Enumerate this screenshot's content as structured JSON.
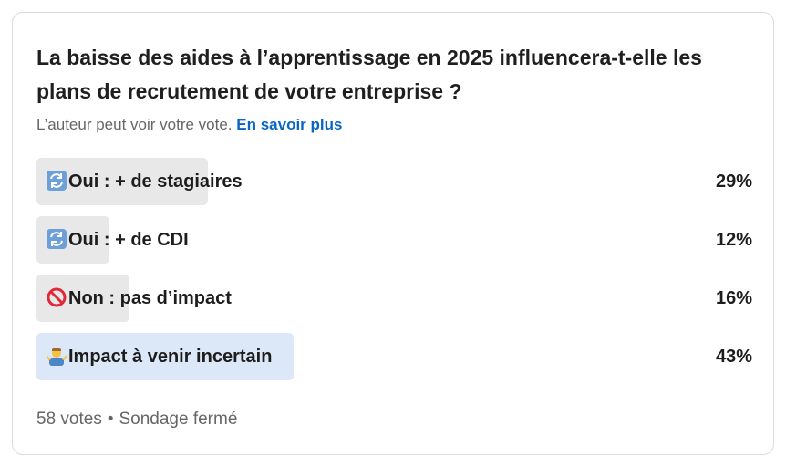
{
  "poll": {
    "question": "La baisse des aides à l’apprentissage en 2025 influencera-t-elle les plans de recrutement de votre entreprise ?",
    "visibility_note": "L’auteur peut voir votre vote.",
    "learn_more": "En savoir plus",
    "options": [
      {
        "emoji": "arrows-icon",
        "label": "Oui : + de stagiaires",
        "percent": "29%",
        "value": 29
      },
      {
        "emoji": "arrows-icon",
        "label": "Oui : + de CDI",
        "percent": "12%",
        "value": 12
      },
      {
        "emoji": "no-entry-icon",
        "label": "Non : pas d’impact",
        "percent": "16%",
        "value": 16
      },
      {
        "emoji": "shrug-icon",
        "label": "Impact à venir incertain",
        "percent": "43%",
        "value": 43,
        "selected": true
      }
    ],
    "votes": "58 votes",
    "separator": "•",
    "status": "Sondage fermé"
  },
  "colors": {
    "bar": "#e8e8e8",
    "selected_bar": "#dce8f7",
    "link": "#0a66c2",
    "muted_text": "#666666"
  }
}
